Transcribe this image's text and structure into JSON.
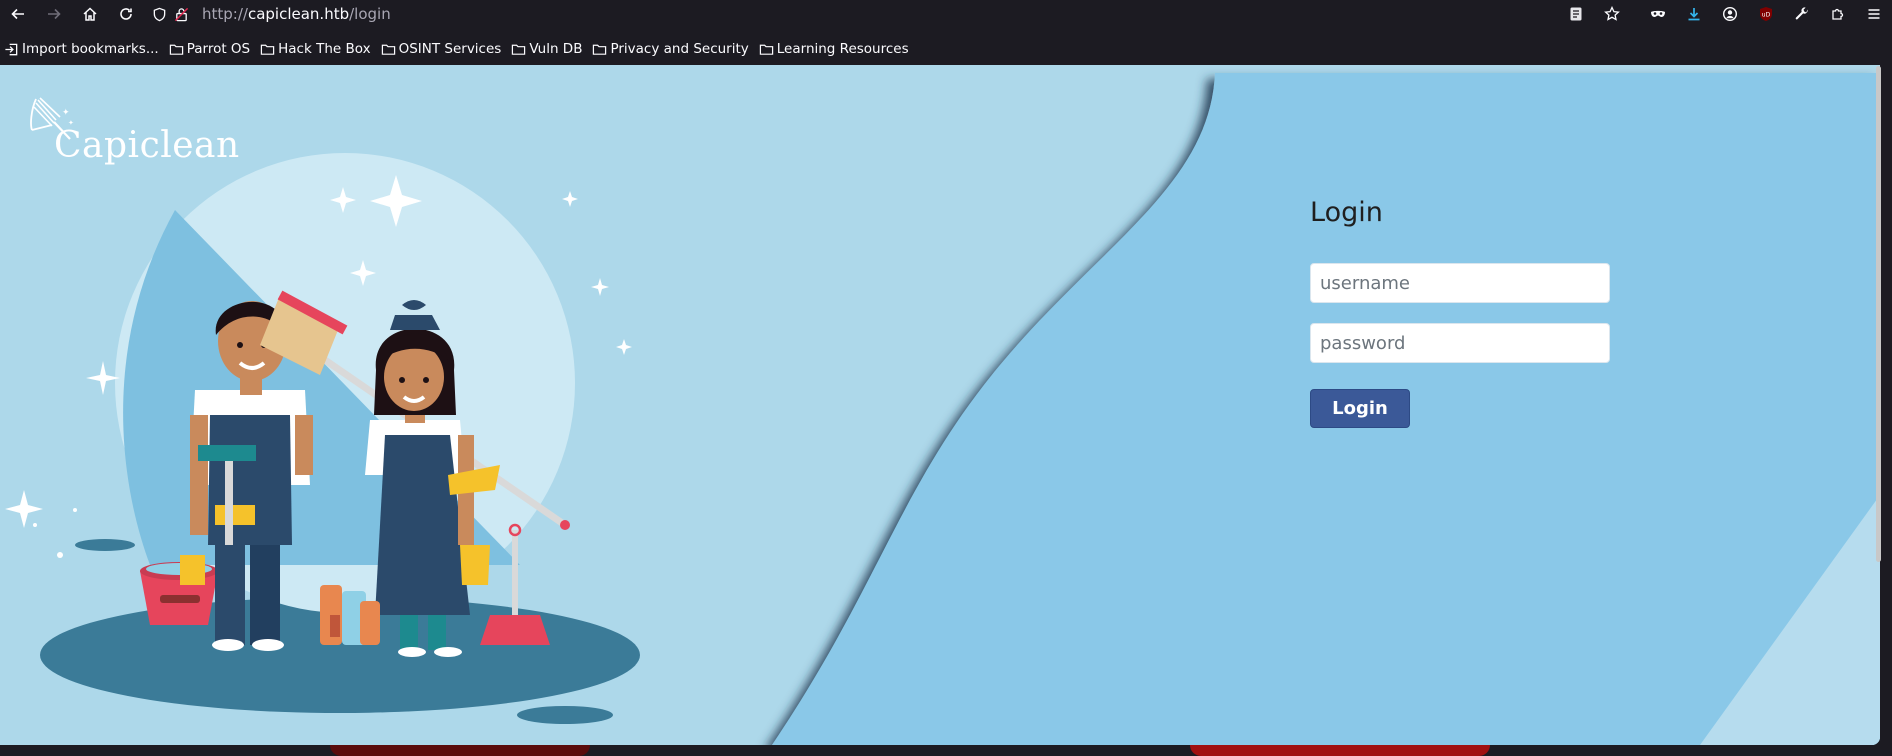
{
  "browser": {
    "url_scheme": "http://",
    "url_host": "capiclean.htb",
    "url_path": "/login",
    "bookmarks": [
      {
        "label": "Import bookmarks...",
        "icon": "import-icon"
      },
      {
        "label": "Parrot OS",
        "icon": "folder-icon"
      },
      {
        "label": "Hack The Box",
        "icon": "folder-icon"
      },
      {
        "label": "OSINT Services",
        "icon": "folder-icon"
      },
      {
        "label": "Vuln DB",
        "icon": "folder-icon"
      },
      {
        "label": "Privacy and Security",
        "icon": "folder-icon"
      },
      {
        "label": "Learning Resources",
        "icon": "folder-icon"
      }
    ]
  },
  "page": {
    "logo_text": "Capiclean",
    "login": {
      "title": "Login",
      "username_placeholder": "username",
      "password_placeholder": "password",
      "button_label": "Login"
    }
  },
  "colors": {
    "background_light": "#add8ea",
    "panel_blue": "#8ac8e8",
    "button_blue": "#3b5998",
    "toolbar_dark": "#1c1b22"
  }
}
